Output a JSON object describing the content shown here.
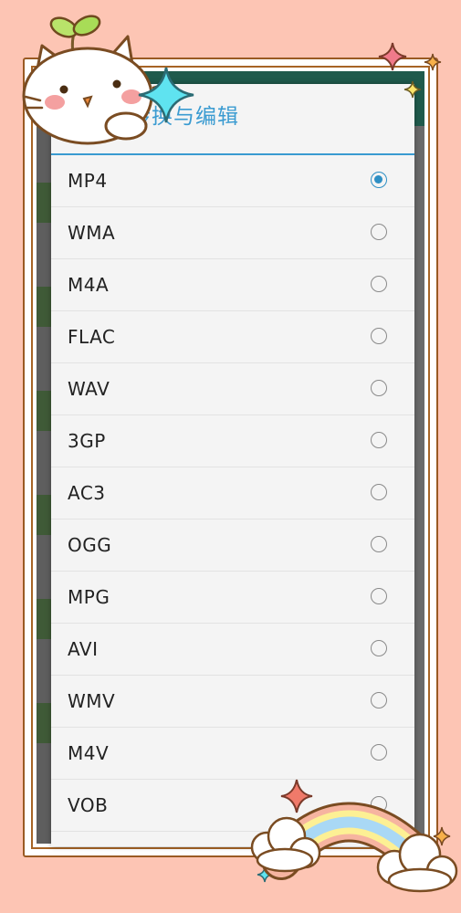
{
  "dialog": {
    "title": "式转换与编辑",
    "options": [
      {
        "label": "MP4",
        "selected": true
      },
      {
        "label": "WMA",
        "selected": false
      },
      {
        "label": "M4A",
        "selected": false
      },
      {
        "label": "FLAC",
        "selected": false
      },
      {
        "label": "WAV",
        "selected": false
      },
      {
        "label": "3GP",
        "selected": false
      },
      {
        "label": "AC3",
        "selected": false
      },
      {
        "label": "OGG",
        "selected": false
      },
      {
        "label": "MPG",
        "selected": false
      },
      {
        "label": "AVI",
        "selected": false
      },
      {
        "label": "WMV",
        "selected": false
      },
      {
        "label": "M4V",
        "selected": false
      },
      {
        "label": "VOB",
        "selected": false
      }
    ]
  },
  "theme": {
    "background": "#fdc5b4",
    "accent": "#3a9bd1",
    "app_bar": "#1f5a4c"
  },
  "decorations": {
    "cat": "cat-sprout-sticker",
    "rainbow": "rainbow-cloud-sticker",
    "sparkles": [
      "sparkle-cyan-icon",
      "sparkle-pink-icon",
      "sparkle-orange-icon"
    ]
  }
}
